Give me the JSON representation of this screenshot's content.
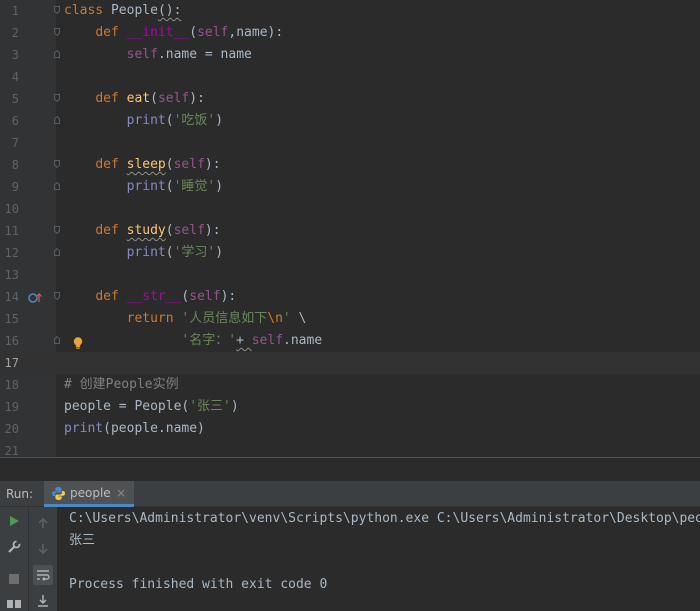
{
  "editor": {
    "line_numbers": [
      "1",
      "2",
      "3",
      "4",
      "5",
      "6",
      "7",
      "8",
      "9",
      "10",
      "11",
      "12",
      "13",
      "14",
      "15",
      "16",
      "17",
      "18",
      "19",
      "20",
      "21"
    ],
    "code": {
      "l1": {
        "kw": "class",
        "name": " People",
        "rest": "():"
      },
      "l2": {
        "kw": "def",
        "name": "__init__",
        "open": "(",
        "self": "self",
        "rest": ",name):"
      },
      "l3": {
        "self": "self",
        "rest": ".name = name"
      },
      "l5": {
        "kw": "def",
        "name": "eat",
        "open": "(",
        "self": "self",
        "rest": "):"
      },
      "l6": {
        "fn": "print",
        "open": "(",
        "str": "'吃饭'",
        "close": ")"
      },
      "l8": {
        "kw": "def",
        "name": "sleep",
        "open": "(",
        "self": "self",
        "rest": "):"
      },
      "l9": {
        "fn": "print",
        "open": "(",
        "str": "'睡觉'",
        "close": ")"
      },
      "l11": {
        "kw": "def",
        "name": "study",
        "open": "(",
        "self": "self",
        "rest": "):"
      },
      "l12": {
        "fn": "print",
        "open": "(",
        "str": "'学习'",
        "close": ")"
      },
      "l14": {
        "kw": "def",
        "name": "__str__",
        "open": "(",
        "self": "self",
        "rest": "):"
      },
      "l15": {
        "kw": "return",
        "str": "'人员信息如下",
        "esc": "\\n",
        "str_end": "'",
        "rest": " \\"
      },
      "l16": {
        "str": "'名字：'",
        "plus": "+ ",
        "self": "self",
        "rest": ".name"
      },
      "l18": {
        "comment": "# 创建People实例"
      },
      "l19": {
        "pre": "people = People(",
        "str": "'张三'",
        "close": ")"
      },
      "l20": {
        "fn": "print",
        "rest": "(people.name)"
      }
    }
  },
  "run_panel": {
    "label": "Run:",
    "tab_label": "people",
    "close_glyph": "×",
    "icons": [
      "run-icon",
      "wrench-icon",
      "stop-icon",
      "layout-icon",
      "up-arrow-icon",
      "down-arrow-icon",
      "soft-wrap-icon",
      "scroll-to-end-icon"
    ],
    "output": [
      "C:\\Users\\Administrator\\venv\\Scripts\\python.exe C:\\Users\\Administrator\\Desktop\\people.py",
      "张三",
      "",
      "Process finished with exit code 0"
    ]
  },
  "colors": {
    "editor_bg": "#2b2b2b",
    "gutter_bg": "#313335",
    "keyword": "#cc7832",
    "self": "#94558d",
    "string": "#6a8759",
    "dunder": "#b200b2",
    "function": "#ffc66d",
    "builtin": "#8888c6",
    "comment": "#808080",
    "run_green": "#499c54"
  }
}
